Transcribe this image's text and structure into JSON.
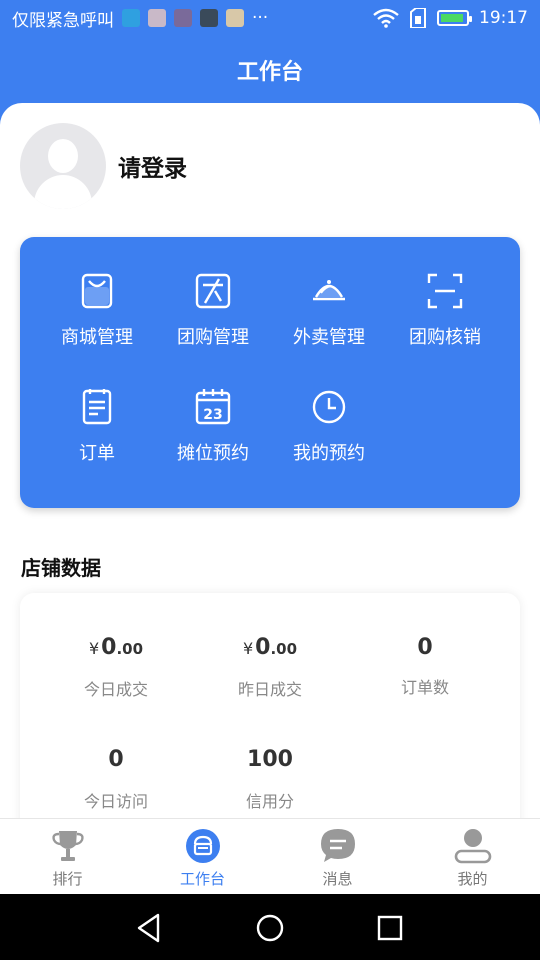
{
  "status_bar": {
    "carrier": "仅限紧急呼叫",
    "more": "···",
    "time": "19:17"
  },
  "header": {
    "title": "工作台"
  },
  "profile": {
    "login_text": "请登录"
  },
  "menu": [
    {
      "label": "商城管理",
      "icon": "shopping-bag-icon"
    },
    {
      "label": "团购管理",
      "icon": "edit-square-icon"
    },
    {
      "label": "外卖管理",
      "icon": "food-cloche-icon"
    },
    {
      "label": "团购核销",
      "icon": "scan-icon"
    },
    {
      "label": "订单",
      "icon": "order-list-icon"
    },
    {
      "label": "摊位预约",
      "icon": "calendar-icon"
    },
    {
      "label": "我的预约",
      "icon": "clock-icon"
    }
  ],
  "calendar_day": "23",
  "store_data": {
    "title": "店铺数据",
    "currency": "¥",
    "today_deal": {
      "int": "0",
      "dec": ".00",
      "label": "今日成交"
    },
    "yesterday_deal": {
      "int": "0",
      "dec": ".00",
      "label": "昨日成交"
    },
    "order_count": {
      "value": "0",
      "label": "订单数"
    },
    "today_visits": {
      "value": "0",
      "label": "今日访问"
    },
    "credit_score": {
      "value": "100",
      "label": "信用分"
    }
  },
  "tabs": [
    {
      "label": "排行",
      "icon": "trophy-icon",
      "active": false
    },
    {
      "label": "工作台",
      "icon": "workbench-icon",
      "active": true
    },
    {
      "label": "消息",
      "icon": "message-icon",
      "active": false
    },
    {
      "label": "我的",
      "icon": "profile-icon",
      "active": false
    }
  ],
  "colors": {
    "primary": "#3d7ff0",
    "tab_inactive": "#777777"
  }
}
